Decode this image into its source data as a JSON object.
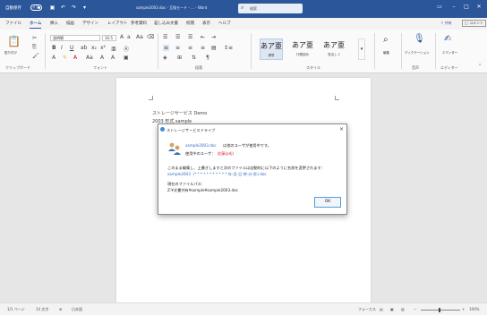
{
  "titlebar": {
    "autosave": "自動保存",
    "toggle": "オフ",
    "doc_title": "sample2003.doc - 互換モード - ... - Word",
    "search_placeholder": "検索"
  },
  "tabs": [
    "ファイル",
    "ホーム",
    "挿入",
    "描画",
    "デザイン",
    "レイアウト",
    "参考資料",
    "差し込み文書",
    "校閲",
    "表示",
    "ヘルプ"
  ],
  "tab_actions": {
    "share": "共有",
    "comment": "コメント"
  },
  "ribbon": {
    "clipboard_label": "クリップボード",
    "paste_label": "貼り付け",
    "font_label": "フォント",
    "font_name": "游明朝",
    "font_size": "10.5",
    "paragraph_label": "段落",
    "style_label": "スタイル",
    "styles": [
      {
        "sample": "あア亜",
        "name": "標準"
      },
      {
        "sample": "あア亜",
        "name": "行間詰め"
      },
      {
        "sample": "あア亜",
        "name": "見出し 1"
      }
    ],
    "edit_label": "編集",
    "voice_button": "ディクテーション",
    "voice_label": "音声",
    "editor_button": "エディター",
    "editor_label": "エディター"
  },
  "document": {
    "lines": [
      "ストレージサービス Demo",
      "2003 形式 sample"
    ]
  },
  "dialog": {
    "title": "ストレージサービスドライブ",
    "line1_file": "sample2003.doc",
    "line1_rest": "は他のユーザが使用中です。",
    "line2_label": "使用中のユーザ：",
    "line2_user": "佐藤(pdj)",
    "line3": "このまま編集し、上書きしますと次のファイルは自動的に以下のように名前を変更されます：",
    "line4": "sample2003（* * * * * * * * * * * 年-月-日 時-分-秒).doc",
    "line5": "現在のファイルパス：",
    "line6": "Z:¥文書共有¥sample¥sample2003.doc",
    "ok_label": "OK"
  },
  "statusbar": {
    "page": "1/1 ページ",
    "words": "14 文字",
    "lang": "日本語",
    "focus": "フォーカス",
    "zoom": "100%"
  },
  "colors": {
    "accent": "#2b579a",
    "link": "#2b6cc4",
    "warning": "#dd2233"
  }
}
